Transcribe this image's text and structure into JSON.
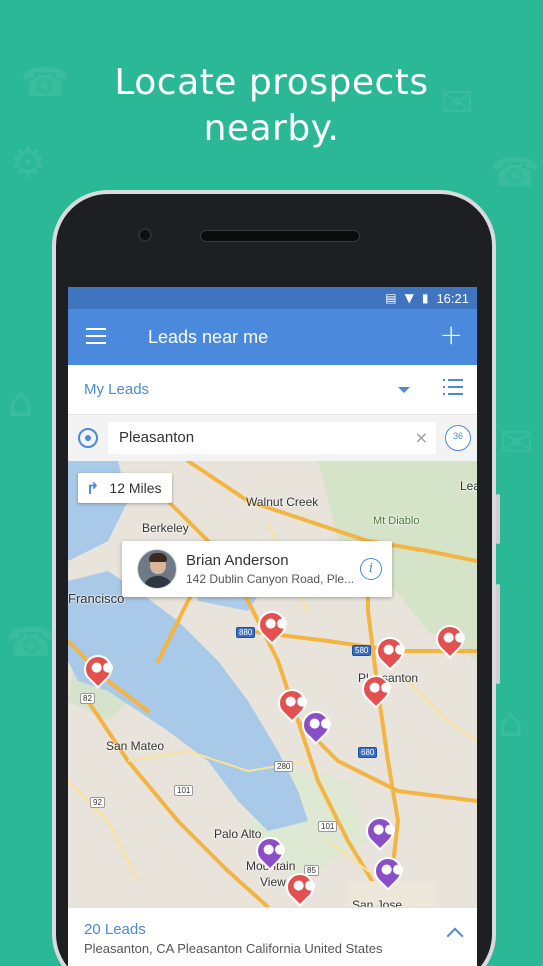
{
  "headline": {
    "line1": "Locate prospects",
    "line2": "nearby."
  },
  "status_bar": {
    "time": "16:21",
    "icons": [
      "vibrate-icon",
      "wifi-icon",
      "battery-icon"
    ]
  },
  "app_bar": {
    "title": "Leads near me",
    "menu_icon": "hamburger-icon",
    "add_icon": "plus-icon"
  },
  "filter": {
    "selected": "My Leads"
  },
  "search": {
    "value": "Pleasanton",
    "radius_label": "36"
  },
  "map": {
    "distance_chip": "12 Miles",
    "places": [
      "Walnut Creek",
      "Berkeley",
      "Mt Diablo",
      "Francisco",
      "San Mateo",
      "Palo Alto",
      "Mountain",
      "View",
      "Pleasanton",
      "San Jose",
      "Lea"
    ],
    "shields": [
      "880",
      "580",
      "680",
      "82",
      "101",
      "92",
      "280",
      "101",
      "85"
    ],
    "callout": {
      "name": "Brian Anderson",
      "address": "142 Dublin Canyon Road, Ple..."
    }
  },
  "bottom_sheet": {
    "count": "20 Leads",
    "location": "Pleasanton, CA Pleasanton California United States"
  },
  "colors": {
    "background": "#2bb896",
    "app_bar": "#4a89dc",
    "status_bar": "#3f74bf",
    "pin_red": "#e25050",
    "pin_purple": "#8a4fc7"
  }
}
